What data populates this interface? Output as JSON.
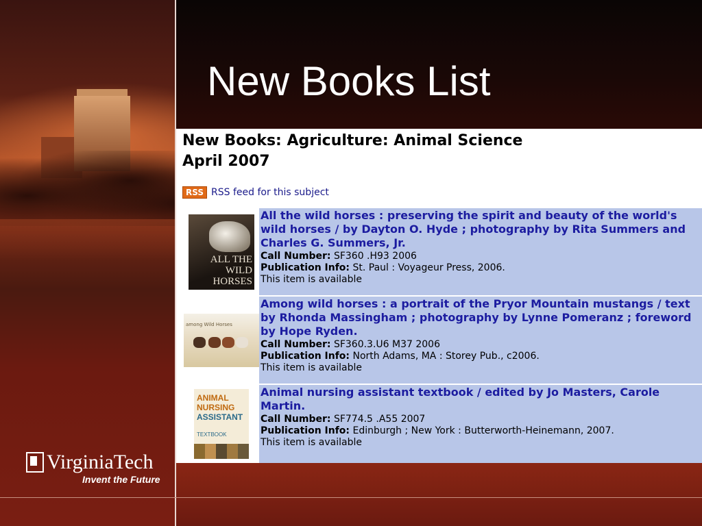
{
  "slide": {
    "title": "New Books List"
  },
  "branding": {
    "name": "VirginiaTech",
    "tagline": "Invent the Future"
  },
  "page": {
    "heading_line1": "New Books: Agriculture: Animal Science",
    "heading_line2": "April 2007",
    "rss_badge": "RSS",
    "rss_label": "RSS feed for this subject"
  },
  "labels": {
    "call_number": "Call Number:",
    "publication_info": "Publication Info:"
  },
  "books": [
    {
      "title": "All the wild horses : preserving the spirit and beauty of the world's wild horses / by Dayton O. Hyde ; photography by Rita Summers and Charles G. Summers, Jr.",
      "call_number": "SF360 .H93 2006",
      "publication_info": "St. Paul : Voyageur Press, 2006.",
      "status": "This item is available",
      "cover_text": "ALL THE WILD HORSES"
    },
    {
      "title": "Among wild horses : a portrait of the Pryor Mountain mustangs / text by Rhonda Massingham ; photography by Lynne Pomeranz ; foreword by Hope Ryden.",
      "call_number": "SF360.3.U6 M37 2006",
      "publication_info": "North Adams, MA : Storey Pub., c2006.",
      "status": "This item is available",
      "cover_text": "among Wild Horses"
    },
    {
      "title": "Animal nursing assistant textbook / edited by Jo Masters, Carole Martin.",
      "call_number": "SF774.5 .A55 2007",
      "publication_info": "Edinburgh ; New York : Butterworth-Heinemann, 2007.",
      "status": "This item is available",
      "cover_text_1": "ANIMAL",
      "cover_text_2": "NURSING",
      "cover_text_3": "ASSISTANT",
      "cover_text_4": "TEXTBOOK"
    }
  ],
  "colors": {
    "accent_red": "#6b1a10",
    "row_blue": "#b8c6e8",
    "link_blue": "#1c1ca0",
    "rss_orange": "#e06a18"
  }
}
